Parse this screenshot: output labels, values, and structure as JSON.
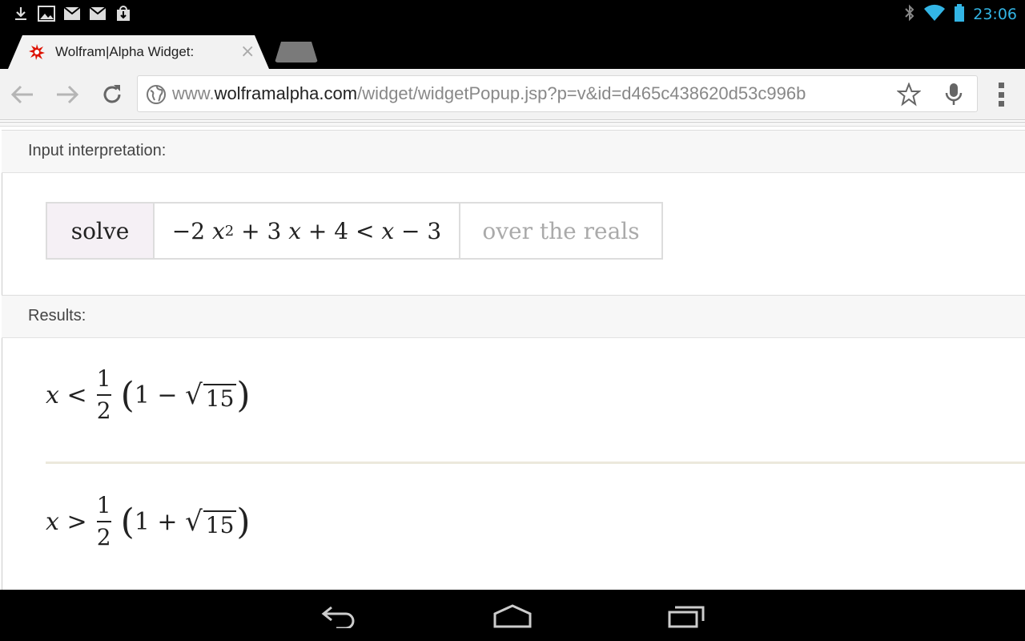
{
  "status_bar": {
    "time": "23:06",
    "notification_icons": [
      "download-icon",
      "image-icon",
      "gmail-icon",
      "gmail-icon",
      "store-download-icon"
    ],
    "system_icons": [
      "bluetooth-icon",
      "wifi-icon",
      "battery-icon"
    ],
    "accent_color": "#33b5e5"
  },
  "browser": {
    "tab": {
      "title": "Wolfram|Alpha Widget:",
      "favicon": "wolfram-star-icon"
    },
    "url": {
      "prefix": "www.",
      "host": "wolframalpha.com",
      "path": "/widget/widgetPopup.jsp?p=v&id=d465c438620d53c996b"
    }
  },
  "pods": {
    "input": {
      "title": "Input interpretation:",
      "solve_label": "solve",
      "expr": {
        "a": "−2",
        "var1": "x",
        "exp": "2",
        "b": "+ 3",
        "var2": "x",
        "c": "+ 4 <",
        "var3": "x",
        "d": "− 3"
      },
      "domain_label": "over the reals"
    },
    "results": {
      "title": "Results:",
      "items": [
        {
          "var": "x",
          "op": "<",
          "num": "1",
          "den": "2",
          "one": "1",
          "sign": "−",
          "radicand": "15"
        },
        {
          "var": "x",
          "op": ">",
          "num": "1",
          "den": "2",
          "one": "1",
          "sign": "+",
          "radicand": "15"
        }
      ]
    }
  }
}
